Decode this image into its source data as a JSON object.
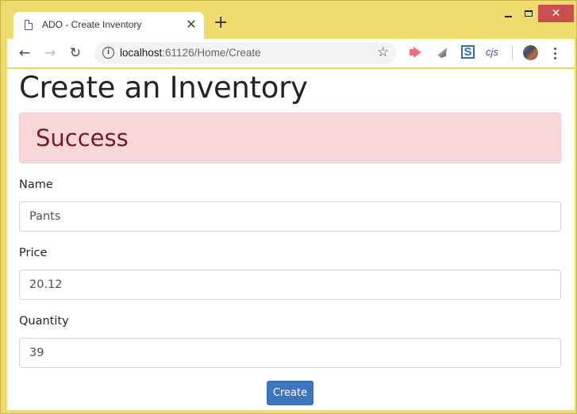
{
  "browser": {
    "tab_title": "ADO - Create Inventory",
    "tab_close": "✕",
    "new_tab": "+",
    "window_close": "✕",
    "nav": {
      "back": "←",
      "forward": "→",
      "reload": "↻"
    },
    "url_host": "localhost",
    "url_rest": ":61126/Home/Create",
    "info_icon": "i",
    "star_icon": "☆",
    "extensions": [
      "send-arrow-extension",
      "shark-extension",
      "s-extension",
      "cjs-extension"
    ],
    "ext_s_label": "S",
    "ext_cjs_label": "cjs"
  },
  "page": {
    "title": "Create an Inventory",
    "alert": {
      "text": "Success",
      "type": "danger-styled"
    },
    "form": {
      "fields": [
        {
          "label": "Name",
          "value": "Pants"
        },
        {
          "label": "Price",
          "value": "20.12"
        },
        {
          "label": "Quantity",
          "value": "39"
        }
      ],
      "submit_label": "Create"
    }
  },
  "colors": {
    "window_frame": "#f0dc6e",
    "alert_bg": "#f8d7da",
    "alert_text": "#721c24",
    "button_primary": "#3d75bf",
    "close_button": "#c94f4f"
  }
}
